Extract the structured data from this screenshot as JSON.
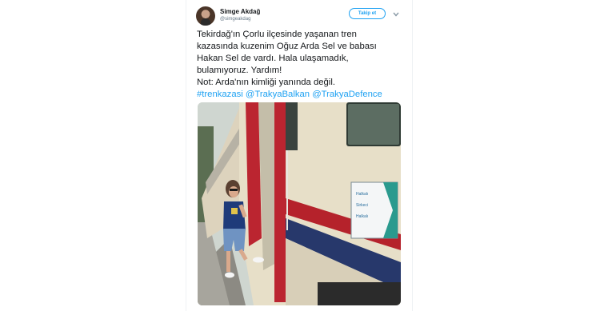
{
  "tweet": {
    "display_name": "Simge Akdağ",
    "handle": "@simgeakdag",
    "follow_label": "Takip et",
    "text_lines": [
      "Tekirdağ'ın Çorlu ilçesinde yaşanan tren",
      "kazasında kuzenim Oğuz Arda Sel ve babası",
      "Hakan Sel de vardı. Hala ulaşamadık,",
      "bulamıyoruz. Yardım!",
      "Not: Arda'nın kimliği yanında değil."
    ],
    "hashtags": [
      "#trenkazasi",
      "@TrakyaBalkan",
      "@TrakyaDefence"
    ]
  },
  "photo": {
    "sign_lines": [
      "Halkalı",
      "Sirkeci",
      "Halkalı"
    ]
  },
  "colors": {
    "link": "#1da1f2",
    "text": "#14171a",
    "muted": "#657786",
    "train_red": "#b5222b",
    "train_blue": "#27386b"
  }
}
